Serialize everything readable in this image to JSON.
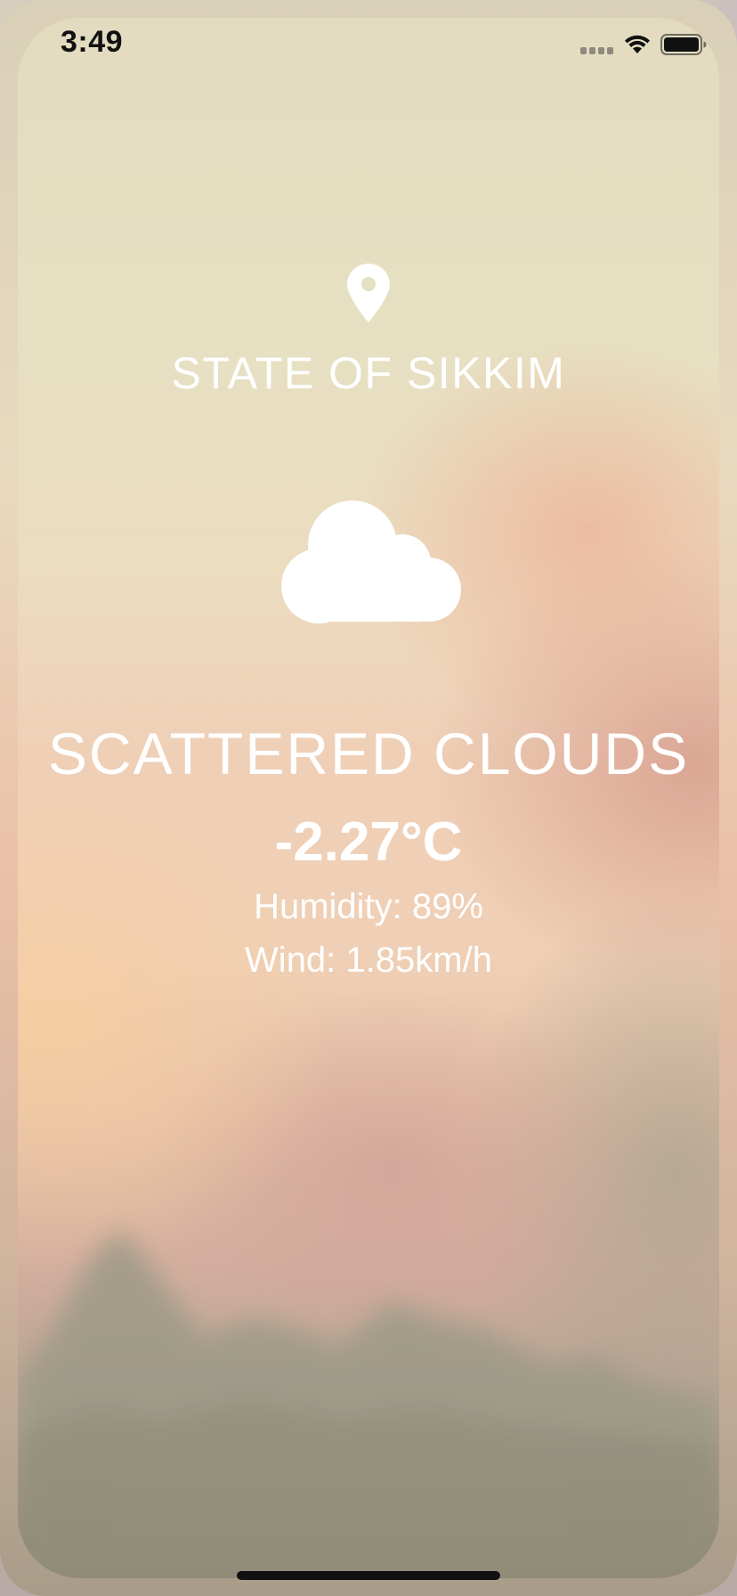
{
  "status_bar": {
    "time": "3:49",
    "signal_icon": "cellular-signal-icon",
    "wifi_icon": "wifi-icon",
    "battery_icon": "battery-full-icon"
  },
  "location": {
    "icon": "location-pin-icon",
    "name": "STATE OF SIKKIM"
  },
  "weather": {
    "icon": "cloud-icon",
    "condition": "SCATTERED CLOUDS",
    "temperature": "-2.27°C",
    "humidity": "Humidity: 89%",
    "wind": "Wind: 1.85km/h"
  },
  "colors": {
    "text": "#ffffff",
    "status_text": "#111111",
    "home_indicator": "#111111"
  }
}
